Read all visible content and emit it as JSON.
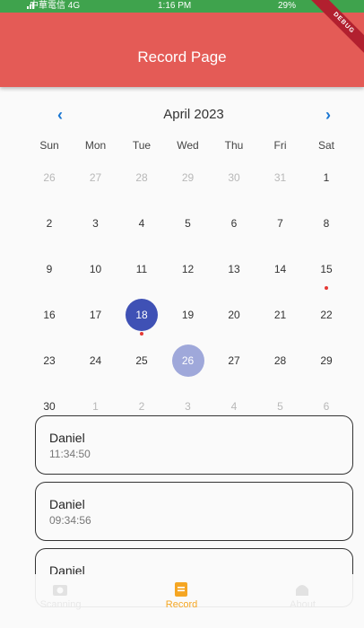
{
  "status_bar": {
    "carrier": "中華電信 4G",
    "time": "1:16 PM",
    "battery": "29%"
  },
  "app_bar": {
    "title": "Record Page",
    "debug_banner": "DEBUG"
  },
  "calendar": {
    "month_label": "April 2023",
    "prev_icon": "chevron-left-icon",
    "next_icon": "chevron-right-icon",
    "weekdays": [
      "Sun",
      "Mon",
      "Tue",
      "Wed",
      "Thu",
      "Fri",
      "Sat"
    ],
    "weeks": [
      [
        "26",
        "27",
        "28",
        "29",
        "30",
        "31",
        "1"
      ],
      [
        "2",
        "3",
        "4",
        "5",
        "6",
        "7",
        "8"
      ],
      [
        "9",
        "10",
        "11",
        "12",
        "13",
        "14",
        "15"
      ],
      [
        "16",
        "17",
        "18",
        "19",
        "20",
        "21",
        "22"
      ],
      [
        "23",
        "24",
        "25",
        "26",
        "27",
        "28",
        "29"
      ],
      [
        "30",
        "1",
        "2",
        "3",
        "4",
        "5",
        "6"
      ]
    ],
    "selected_day": "18",
    "today_day": "26",
    "marked_days": [
      "15",
      "18"
    ],
    "colors": {
      "accent": "#1976d2",
      "selected": "#3f51b5",
      "today": "#9fa8da",
      "marker": "#e53935"
    }
  },
  "records": [
    {
      "name": "Daniel",
      "time": "11:34:50"
    },
    {
      "name": "Daniel",
      "time": "09:34:56"
    },
    {
      "name": "Daniel",
      "time": ""
    }
  ],
  "bottom_nav": {
    "items": [
      {
        "label": "Scanning",
        "icon": "camera-icon",
        "active": false
      },
      {
        "label": "Record",
        "icon": "clipboard-icon",
        "active": true
      },
      {
        "label": "About",
        "icon": "home-icon",
        "active": false
      }
    ],
    "active_color": "#f5a623"
  },
  "theme": {
    "app_bar_color": "#e45b56",
    "status_bar_color": "#3fa34d"
  }
}
